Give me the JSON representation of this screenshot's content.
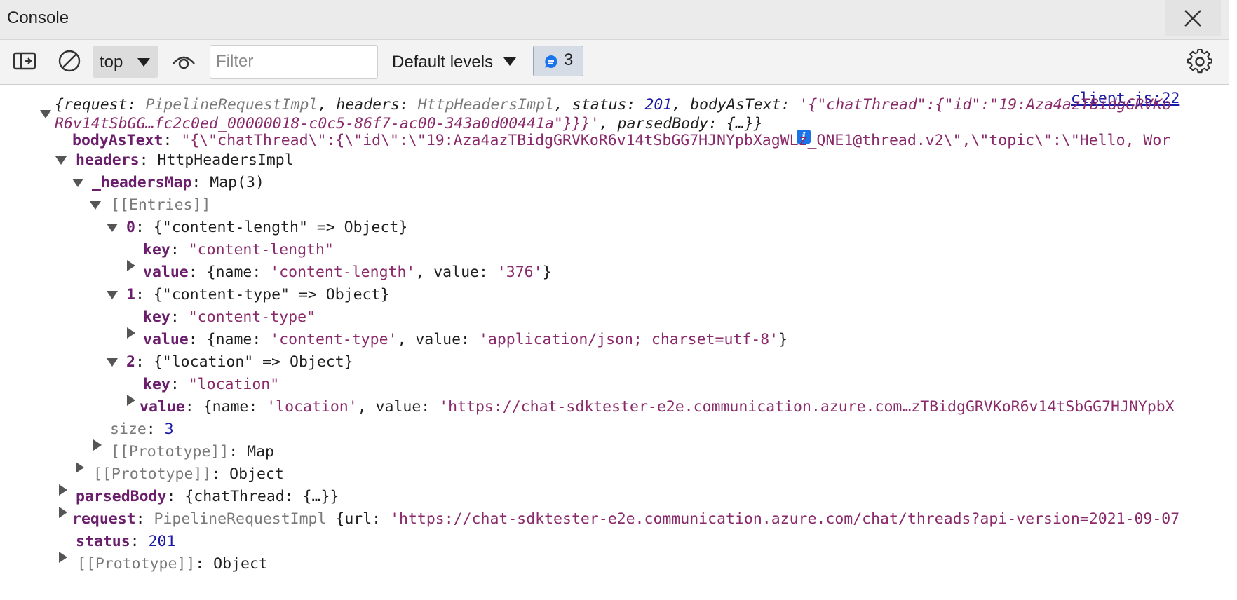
{
  "window": {
    "title": "Console"
  },
  "toolbar": {
    "context": "top",
    "filter_placeholder": "Filter",
    "levels_label": "Default levels",
    "issues_count": "3"
  },
  "console": {
    "source_link": "client.js:22",
    "summary": {
      "line1_a": "{request: ",
      "line1_b": "PipelineRequestImpl",
      "line1_c": ", headers: ",
      "line1_d": "HttpHeadersImpl",
      "line1_e": ", status: ",
      "line1_f": "201",
      "line1_g": ", bodyAsText: ",
      "line1_h": "'{\"chatThread\":{\"id\":\"19:Aza4azTBidgGRVKo",
      "line2_a": "R6v14tSbGG…fc2c0ed_00000018-c0c5-86f7-ac00-343a0d00441a\"}}}'",
      "line2_b": ", parsedBody: {…}}"
    },
    "bodyAsText": {
      "key": "bodyAsText",
      "value": "\"{\\\"chatThread\\\":{\\\"id\\\":\\\"19:Aza4azTBidgGRVKoR6v14tSbGG7HJNYpbXagWLz_QNE1@thread.v2\\\",\\\"topic\\\":\\\"Hello, Wor"
    },
    "headers": {
      "key": "headers",
      "value": "HttpHeadersImpl"
    },
    "headersMap": {
      "key": "_headersMap",
      "value": "Map(3)"
    },
    "entries_label": "[[Entries]]",
    "entries": [
      {
        "index": "0",
        "summary": "{\"content-length\" => Object}",
        "key_label": "key",
        "key_value": "\"content-length\"",
        "value_label": "value",
        "value_pre": "{name: ",
        "value_name": "'content-length'",
        "value_mid": ", value: ",
        "value_value": "'376'",
        "value_post": "}"
      },
      {
        "index": "1",
        "summary": "{\"content-type\" => Object}",
        "key_label": "key",
        "key_value": "\"content-type\"",
        "value_label": "value",
        "value_pre": "{name: ",
        "value_name": "'content-type'",
        "value_mid": ", value: ",
        "value_value": "'application/json; charset=utf-8'",
        "value_post": "}"
      },
      {
        "index": "2",
        "summary": "{\"location\" => Object}",
        "key_label": "key",
        "key_value": "\"location\"",
        "value_label": "value",
        "value_pre": "{name: ",
        "value_name": "'location'",
        "value_mid": ", value: ",
        "value_value": "'https://chat-sdktester-e2e.communication.azure.com…zTBidgGRVKoR6v14tSbGG7HJNYpbX",
        "value_post": ""
      }
    ],
    "size": {
      "key": "size",
      "value": "3"
    },
    "map_proto": {
      "key": "[[Prototype]]",
      "value": "Map"
    },
    "headers_proto": {
      "key": "[[Prototype]]",
      "value": "Object"
    },
    "parsedBody": {
      "key": "parsedBody",
      "value": "{chatThread: {…}}"
    },
    "request": {
      "key": "request",
      "type": "PipelineRequestImpl",
      "pre": " {url: ",
      "url": "'https://chat-sdktester-e2e.communication.azure.com/chat/threads?api-version=2021-09-07"
    },
    "status": {
      "key": "status",
      "value": "201"
    },
    "root_proto": {
      "key": "[[Prototype]]",
      "value": "Object"
    }
  }
}
